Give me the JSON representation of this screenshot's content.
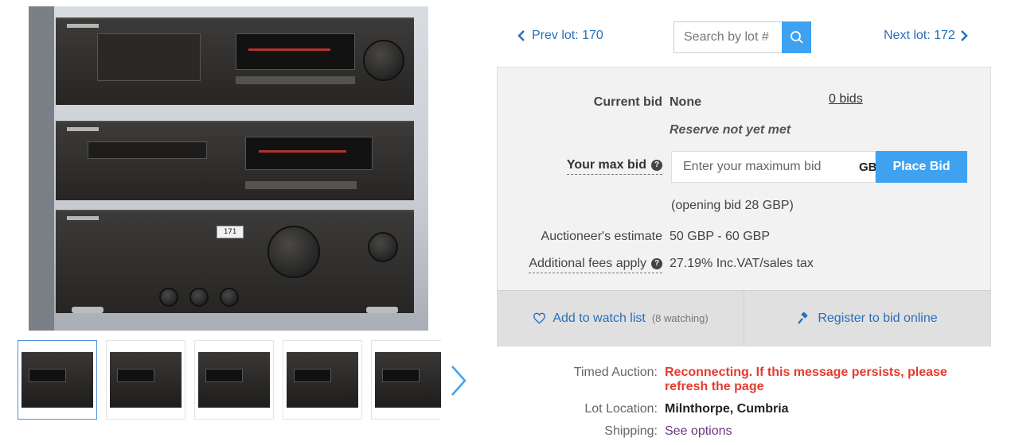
{
  "navigation": {
    "prev_lot": "Prev lot: 170",
    "next_lot": "Next lot: 172",
    "search_placeholder": "Search by lot #"
  },
  "gallery": {
    "main_photo_lot_tag": "171",
    "thumbnail_count": 5
  },
  "bid_panel": {
    "current_bid_label": "Current bid",
    "current_bid_value": "None",
    "bids_link": "0 bids",
    "reserve_status": "Reserve not yet met",
    "max_bid_label": "Your max bid",
    "max_bid_placeholder": "Enter your maximum bid",
    "currency": "GBP",
    "place_bid_label": "Place Bid",
    "opening_bid": "(opening bid 28 GBP)",
    "estimate_label": "Auctioneer's estimate",
    "estimate_value": "50 GBP - 60 GBP",
    "fees_label": "Additional fees apply",
    "fees_value": "27.19% Inc.VAT/sales tax",
    "watch_label": "Add to watch list",
    "watch_count": "(8 watching)",
    "register_label": "Register to bid online"
  },
  "info": {
    "timed_label": "Timed Auction:",
    "timed_value": "Reconnecting. If this message persists, please refresh the page",
    "location_label": "Lot Location:",
    "location_value": "Milnthorpe, Cumbria",
    "shipping_label": "Shipping:",
    "shipping_value": "See options"
  },
  "colors": {
    "accent": "#3ea2f1",
    "link": "#2a6ebb",
    "error": "#e33b2e",
    "panel_bg": "#f2f2f2",
    "panel_footer_bg": "#e0e0e0"
  }
}
